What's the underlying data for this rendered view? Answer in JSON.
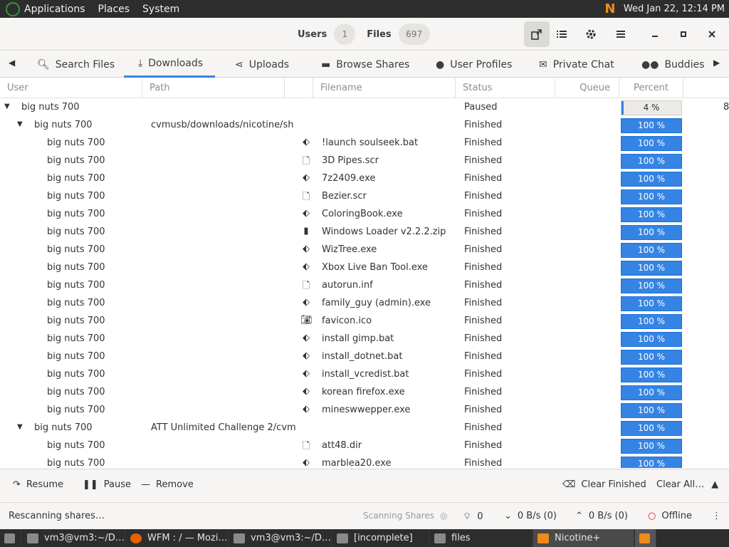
{
  "top_panel": {
    "menus": [
      "Applications",
      "Places",
      "System"
    ],
    "clock": "Wed Jan 22, 12:14 PM"
  },
  "header": {
    "users_label": "Users",
    "users_count": "1",
    "files_label": "Files",
    "files_count": "697"
  },
  "tabs": [
    {
      "label": "Search Files",
      "icon": "search-icon"
    },
    {
      "label": "Downloads",
      "icon": "download-icon"
    },
    {
      "label": "Uploads",
      "icon": "share-icon"
    },
    {
      "label": "Browse Shares",
      "icon": "folder-icon"
    },
    {
      "label": "User Profiles",
      "icon": "person-icon"
    },
    {
      "label": "Private Chat",
      "icon": "envelope-icon"
    },
    {
      "label": "Buddies",
      "icon": "people-icon"
    }
  ],
  "columns": {
    "user": "User",
    "path": "Path",
    "filename": "Filename",
    "status": "Status",
    "queue": "Queue",
    "percent": "Percent"
  },
  "rows": [
    {
      "level": 0,
      "expander": true,
      "user": "big nuts 700",
      "path": "",
      "icon": "",
      "filename": "",
      "status": "Paused",
      "percent": "4 %",
      "progress": 0.04,
      "extra": "8"
    },
    {
      "level": 1,
      "expander": true,
      "user": "big nuts 700",
      "path": "cvmusb/downloads/nicotine/sh",
      "icon": "",
      "filename": "",
      "status": "Finished",
      "percent": "100 %",
      "progress": 1.0
    },
    {
      "level": 2,
      "expander": false,
      "user": "big nuts 700",
      "path": "",
      "icon": "exec",
      "filename": "!launch soulseek.bat",
      "status": "Finished",
      "percent": "100 %",
      "progress": 1.0
    },
    {
      "level": 2,
      "expander": false,
      "user": "big nuts 700",
      "path": "",
      "icon": "doc",
      "filename": "3D Pipes.scr",
      "status": "Finished",
      "percent": "100 %",
      "progress": 1.0
    },
    {
      "level": 2,
      "expander": false,
      "user": "big nuts 700",
      "path": "",
      "icon": "exec",
      "filename": "7z2409.exe",
      "status": "Finished",
      "percent": "100 %",
      "progress": 1.0
    },
    {
      "level": 2,
      "expander": false,
      "user": "big nuts 700",
      "path": "",
      "icon": "doc",
      "filename": "Bezier.scr",
      "status": "Finished",
      "percent": "100 %",
      "progress": 1.0
    },
    {
      "level": 2,
      "expander": false,
      "user": "big nuts 700",
      "path": "",
      "icon": "exec",
      "filename": "ColoringBook.exe",
      "status": "Finished",
      "percent": "100 %",
      "progress": 1.0
    },
    {
      "level": 2,
      "expander": false,
      "user": "big nuts 700",
      "path": "",
      "icon": "archive",
      "filename": "Windows Loader v2.2.2.zip",
      "status": "Finished",
      "percent": "100 %",
      "progress": 1.0
    },
    {
      "level": 2,
      "expander": false,
      "user": "big nuts 700",
      "path": "",
      "icon": "exec",
      "filename": "WizTree.exe",
      "status": "Finished",
      "percent": "100 %",
      "progress": 1.0
    },
    {
      "level": 2,
      "expander": false,
      "user": "big nuts 700",
      "path": "",
      "icon": "exec",
      "filename": "Xbox Live Ban Tool.exe",
      "status": "Finished",
      "percent": "100 %",
      "progress": 1.0
    },
    {
      "level": 2,
      "expander": false,
      "user": "big nuts 700",
      "path": "",
      "icon": "doc",
      "filename": "autorun.inf",
      "status": "Finished",
      "percent": "100 %",
      "progress": 1.0
    },
    {
      "level": 2,
      "expander": false,
      "user": "big nuts 700",
      "path": "",
      "icon": "exec",
      "filename": "family_guy (admin).exe",
      "status": "Finished",
      "percent": "100 %",
      "progress": 1.0
    },
    {
      "level": 2,
      "expander": false,
      "user": "big nuts 700",
      "path": "",
      "icon": "image",
      "filename": "favicon.ico",
      "status": "Finished",
      "percent": "100 %",
      "progress": 1.0
    },
    {
      "level": 2,
      "expander": false,
      "user": "big nuts 700",
      "path": "",
      "icon": "exec",
      "filename": "install gimp.bat",
      "status": "Finished",
      "percent": "100 %",
      "progress": 1.0
    },
    {
      "level": 2,
      "expander": false,
      "user": "big nuts 700",
      "path": "",
      "icon": "exec",
      "filename": "install_dotnet.bat",
      "status": "Finished",
      "percent": "100 %",
      "progress": 1.0
    },
    {
      "level": 2,
      "expander": false,
      "user": "big nuts 700",
      "path": "",
      "icon": "exec",
      "filename": "install_vcredist.bat",
      "status": "Finished",
      "percent": "100 %",
      "progress": 1.0
    },
    {
      "level": 2,
      "expander": false,
      "user": "big nuts 700",
      "path": "",
      "icon": "exec",
      "filename": "korean firefox.exe",
      "status": "Finished",
      "percent": "100 %",
      "progress": 1.0
    },
    {
      "level": 2,
      "expander": false,
      "user": "big nuts 700",
      "path": "",
      "icon": "exec",
      "filename": "mineswwepper.exe",
      "status": "Finished",
      "percent": "100 %",
      "progress": 1.0
    },
    {
      "level": 1,
      "expander": true,
      "user": "big nuts 700",
      "path": "ATT Unlimited Challenge 2/cvm",
      "icon": "",
      "filename": "",
      "status": "Finished",
      "percent": "100 %",
      "progress": 1.0
    },
    {
      "level": 2,
      "expander": false,
      "user": "big nuts 700",
      "path": "",
      "icon": "doc",
      "filename": "att48.dir",
      "status": "Finished",
      "percent": "100 %",
      "progress": 1.0
    },
    {
      "level": 2,
      "expander": false,
      "user": "big nuts 700",
      "path": "",
      "icon": "exec",
      "filename": "marblea20.exe",
      "status": "Finished",
      "percent": "100 %",
      "progress": 1.0
    }
  ],
  "actions": {
    "resume": "Resume",
    "pause": "Pause",
    "remove": "Remove",
    "clear_finished": "Clear Finished",
    "clear_all": "Clear All…"
  },
  "statusbar": {
    "message": "Rescanning shares…",
    "scanning": "Scanning Shares",
    "connections": "0",
    "download_speed": "0 B/s (0)",
    "upload_speed": "0 B/s (0)",
    "status": "Offline"
  },
  "taskbar": [
    {
      "label": "vm3@vm3:~/D…",
      "icon": "terminal-icon"
    },
    {
      "label": "WFM : / — Mozi…",
      "icon": "firefox-icon"
    },
    {
      "label": "vm3@vm3:~/D…",
      "icon": "terminal-icon"
    },
    {
      "label": "[incomplete]",
      "icon": "folder-icon"
    },
    {
      "label": "files",
      "icon": "folder-icon"
    },
    {
      "label": "Nicotine+",
      "icon": "nicotine-icon"
    }
  ],
  "colors": {
    "accent": "#3584e4",
    "panel": "#2d2d2d",
    "offline": "#e01b24"
  }
}
